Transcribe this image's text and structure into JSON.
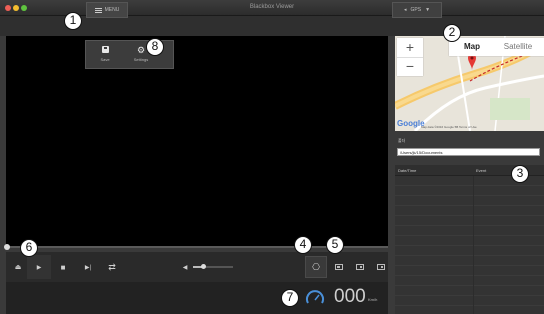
{
  "window": {
    "title": "Blackbox Viewer"
  },
  "toolbar": {
    "menu_label": "MENU",
    "gps_label": "GPS"
  },
  "menu_dropdown": {
    "items": [
      {
        "label": "Save",
        "icon": "save-icon"
      },
      {
        "label": "Settings",
        "icon": "gear-icon"
      }
    ]
  },
  "player": {
    "volume": 0.25
  },
  "speed": {
    "value": "000",
    "unit": "Km/h"
  },
  "map": {
    "map_type_selected": "Map",
    "map_type_other": "Satellite",
    "zoom_in": "+",
    "zoom_out": "−",
    "logo": "Google",
    "credit": "Map data ©2016 Google  5B  Terms of Use"
  },
  "file_path": {
    "label": "폴더",
    "value": "/Users/jk/15/Documents"
  },
  "event_list": {
    "columns": [
      "Date/Time",
      "Event"
    ],
    "rows": []
  },
  "annotations": [
    "1",
    "2",
    "3",
    "4",
    "5",
    "6",
    "7",
    "8"
  ],
  "colors": {
    "accent_marker": "#e53935",
    "route": "#c62828"
  }
}
